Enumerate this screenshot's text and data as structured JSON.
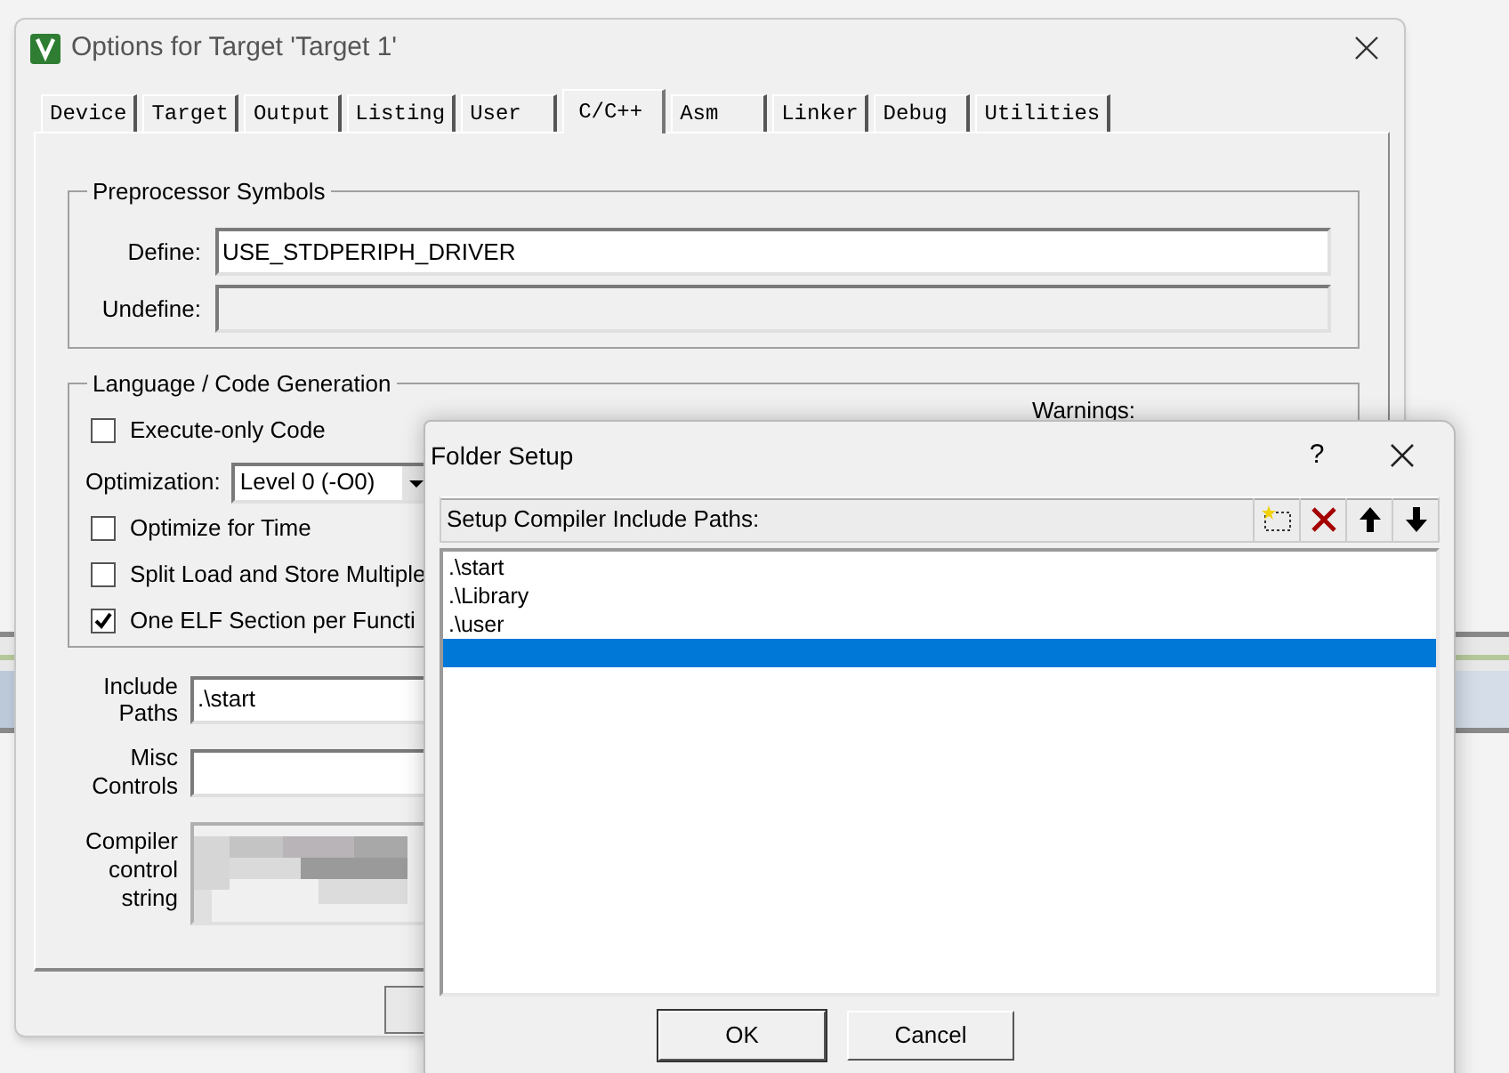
{
  "main_window": {
    "title": "Options for Target 'Target 1'",
    "tabs": [
      {
        "label": "Device",
        "selected": false
      },
      {
        "label": "Target",
        "selected": false
      },
      {
        "label": "Output",
        "selected": false
      },
      {
        "label": "Listing",
        "selected": false
      },
      {
        "label": "User",
        "selected": false
      },
      {
        "label": "C/C++",
        "selected": true
      },
      {
        "label": "Asm",
        "selected": false
      },
      {
        "label": "Linker",
        "selected": false
      },
      {
        "label": "Debug",
        "selected": false
      },
      {
        "label": "Utilities",
        "selected": false
      }
    ],
    "preprocessor": {
      "title": "Preprocessor Symbols",
      "fields": [
        {
          "label": "Define:",
          "value": "USE_STDPERIPH_DRIVER",
          "disabled": false
        },
        {
          "label": "Undefine:",
          "disabled": true
        }
      ]
    },
    "language": {
      "title": "Language / Code Generation",
      "options": [
        {
          "kind": "checkbox",
          "label": "Execute-only Code",
          "checked": false
        },
        {
          "kind": "select",
          "label": "Optimization:",
          "value": "Level 0 (-O0)"
        },
        {
          "kind": "checkbox",
          "label": "Optimize for Time",
          "checked": false
        },
        {
          "kind": "checkbox",
          "label": "Split Load and Store Multiple",
          "checked": false
        },
        {
          "kind": "checkbox",
          "label": "One ELF Section per Functi",
          "checked": true
        }
      ],
      "warnings_label": "Warnings:"
    },
    "include_paths": {
      "label": "Include Paths",
      "value": ".\\start"
    },
    "misc_controls": {
      "label": "Misc Controls"
    },
    "compiler_control": {
      "label": "Compiler control string"
    }
  },
  "folder_setup": {
    "title": "Folder Setup",
    "help": "?",
    "header": "Setup Compiler Include Paths:",
    "paths": [
      {
        "text": ".\\start",
        "selected": false
      },
      {
        "text": ".\\Library",
        "selected": false
      },
      {
        "text": ".\\user",
        "selected": false
      },
      {
        "selected": true
      }
    ],
    "buttons": [
      "OK",
      "Cancel"
    ]
  }
}
